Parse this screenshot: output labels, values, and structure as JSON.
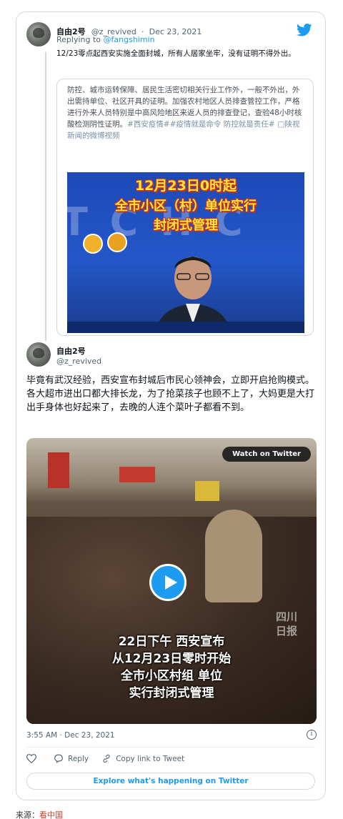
{
  "parent_tweet": {
    "display_name": "自由2号",
    "handle": "@z_revived",
    "separator": "·",
    "date": "Dec 23, 2021",
    "replying_prefix": "Replying to ",
    "replying_to": "@fangshimin",
    "text": "12/23零点起西安实施全面封城，所有人居家坐牢，没有证明不得外出。",
    "quoted": {
      "text": "防控、城市运转保障、居民生活密切相关行业工作外，一般不外出，外出需持单位、社区开具的证明。加强农村地区人员排查管控工作，严格进行外来人员特别是中高风险地区来返人员的排查登记，查验48小时核酸检测阴性证明。",
      "tags": "#西安疫情##疫情就是命令 防控就是责任#",
      "video_link": "□陕视新闻的微博视频",
      "thumb_caption_1": "12月23日0时起",
      "thumb_caption_2": "全市小区（村）单位实行",
      "thumb_caption_3": "封闭式管理"
    }
  },
  "main_tweet": {
    "display_name": "自由2号",
    "handle": "@z_revived",
    "text": "毕竟有武汉经验，西安宣布封城后市民心领神会，立即开启抢购模式。各大超市进出口都大排长龙，为了抢菜孩子也顾不上了，大妈更是大打出手身体也好起来了，去晚的人连个菜叶子都看不到。",
    "video": {
      "watch_label": "Watch on Twitter",
      "caption_1": "22日下午 西安宣布",
      "caption_2": "从12月23日零时开始",
      "caption_3": "全市小区村组 单位",
      "caption_4": "实行封闭式管理",
      "watermark": "四川日报"
    },
    "timestamp": "3:55 AM · Dec 23, 2021",
    "info_icon_label": "i",
    "actions": {
      "reply_label": "Reply",
      "copy_link_label": "Copy link to Tweet"
    },
    "explore_label": "Explore what's happening on Twitter"
  },
  "footer": {
    "source_label": "来源：",
    "source_link": "看中国"
  },
  "icons": {
    "twitter": "twitter-bird-icon",
    "like": "heart-icon",
    "reply": "reply-bubble-icon",
    "link": "link-icon",
    "play": "play-icon",
    "info": "info-icon"
  },
  "colors": {
    "twitter_blue": "#1d9bf0",
    "text_primary": "#0f1419",
    "text_secondary": "#536471",
    "border": "#cfd9de",
    "source_link": "#d23b2a"
  }
}
